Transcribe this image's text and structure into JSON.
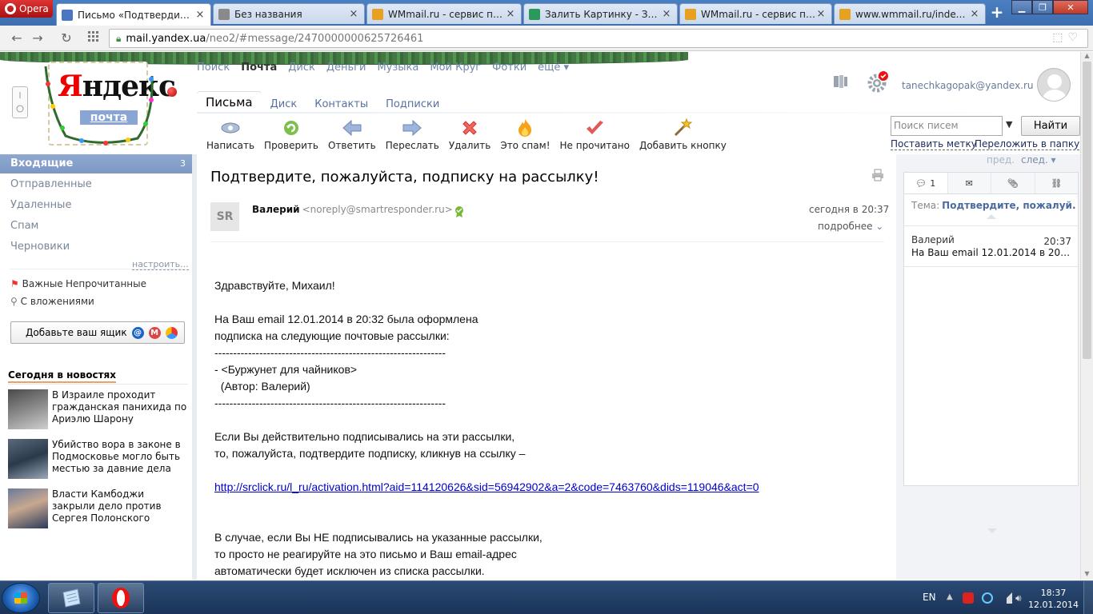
{
  "browser": {
    "menu_label": "Opera",
    "tabs": [
      {
        "title": "Письмо «Подтвердите, по",
        "active": true,
        "fav_color": "#4b76c2"
      },
      {
        "title": "Без названия",
        "active": false,
        "fav_color": "#8a8a8a"
      },
      {
        "title": "WMmail.ru - сервис почт",
        "active": false,
        "fav_color": "#e8a020"
      },
      {
        "title": "Залить Картинку - Загруз",
        "active": false,
        "fav_color": "#2a9a5a"
      },
      {
        "title": "WMmail.ru - сервис почт",
        "active": false,
        "fav_color": "#e8a020"
      },
      {
        "title": "www.wmmail.ru/index.ph",
        "active": false,
        "fav_color": "#e8a020"
      }
    ],
    "new_tab_label": "+",
    "url_host": "mail.yandex.ua",
    "url_path": "/neo2/#message/2470000000625726461"
  },
  "header": {
    "logo_text": "Яндекс",
    "logo_first_letter": "Я",
    "logo_rest": "ндекс",
    "logo_sub": "почта",
    "services": [
      {
        "label": "Поиск",
        "current": false
      },
      {
        "label": "Почта",
        "current": true
      },
      {
        "label": "Диск",
        "current": false
      },
      {
        "label": "Деньги",
        "current": false
      },
      {
        "label": "Музыка",
        "current": false
      },
      {
        "label": "Мой Круг",
        "current": false
      },
      {
        "label": "Фотки",
        "current": false
      },
      {
        "label": "ещё ▾",
        "current": false
      }
    ],
    "login": "tanechkagopak@yandex.ru"
  },
  "mail_tabs": [
    {
      "label": "Письма",
      "current": true
    },
    {
      "label": "Диск",
      "current": false
    },
    {
      "label": "Контакты",
      "current": false
    },
    {
      "label": "Подписки",
      "current": false
    }
  ],
  "toolbar": [
    {
      "label": "Написать",
      "icon": "compose-icon"
    },
    {
      "label": "Проверить",
      "icon": "refresh-icon"
    },
    {
      "label": "Ответить",
      "icon": "reply-icon"
    },
    {
      "label": "Переслать",
      "icon": "forward-icon"
    },
    {
      "label": "Удалить",
      "icon": "delete-icon"
    },
    {
      "label": "Это спам!",
      "icon": "spam-icon"
    },
    {
      "label": "Не прочитано",
      "icon": "unread-icon"
    },
    {
      "label": "Добавить кнопку",
      "icon": "add-button-icon"
    }
  ],
  "search": {
    "placeholder": "Поиск писем",
    "button": "Найти",
    "mark_link": "Поставить метку",
    "move_link": "Переложить в папку"
  },
  "sidebar": {
    "folders": [
      {
        "label": "Входящие",
        "count": "3",
        "current": true
      },
      {
        "label": "Отправленные",
        "count": "",
        "current": false
      },
      {
        "label": "Удаленные",
        "count": "",
        "current": false
      },
      {
        "label": "Спам",
        "count": "",
        "current": false
      },
      {
        "label": "Черновики",
        "count": "",
        "current": false
      }
    ],
    "configure": "настроить...",
    "filter_important": "Важные",
    "filter_unread": "Непрочитанные",
    "filter_attach": "С вложениями",
    "add_mailbox": "Добавьте ваш ящик",
    "news_title": "Сегодня в новостях",
    "news": [
      {
        "text": "В Израиле проходит гражданская панихида по Ариэлю Шарону"
      },
      {
        "text": "Убийство вора в законе в Подмосковье могло быть местью за давние дела"
      },
      {
        "text": "Власти Камбоджи закрыли дело против Сергея Полонского"
      }
    ]
  },
  "message": {
    "subject": "Подтвердите, пожалуйста, подписку на рассылку!",
    "avatar_initials": "SR",
    "from_name": "Валерий",
    "from_email": "<noreply@smartresponder.ru>",
    "date": "сегодня в 20:37",
    "details": "подробнее",
    "body_lines": [
      "Здравствуйте, Михаил!",
      "",
      "На Ваш email 12.01.2014 в 20:32 была оформлена",
      "подписка на следующие почтовые рассылки:",
      "--------------------------------------------------------------",
      "- <Буржунет для чайников>",
      "  (Автор: Валерий)",
      "--------------------------------------------------------------",
      "",
      "Если Вы действительно подписывались на эти рассылки,",
      "то, пожалуйста, подтвердите подписку, кликнув на ссылку –",
      ""
    ],
    "link": "http://srclick.ru/l_ru/activation.html?aid=114120626&sid=56942902&a=2&code=7463760&dids=119046&act=0",
    "body_lines_after": [
      "",
      "",
      "В случае, если Вы НЕ подписывались на указанные рассылки,",
      "то просто не реагируйте на это письмо и Ваш email-адрес",
      "автоматически будет исключен из списка рассылки."
    ]
  },
  "thread_panel": {
    "prev": "пред.",
    "next": "след. ▾",
    "thread_count": "1",
    "topic_label": "Тема:",
    "topic_value": "Подтвердите, пожалуй...",
    "item_name": "Валерий",
    "item_time": "20:37",
    "item_snippet": "На Ваш email 12.01.2014 в 20:..."
  },
  "taskbar": {
    "lang": "EN",
    "time": "18:37",
    "date": "12.01.2014"
  },
  "colors": {
    "accent_blue": "#7d98c4",
    "link": "#0000cc",
    "yandex_red": "#ee0000"
  }
}
